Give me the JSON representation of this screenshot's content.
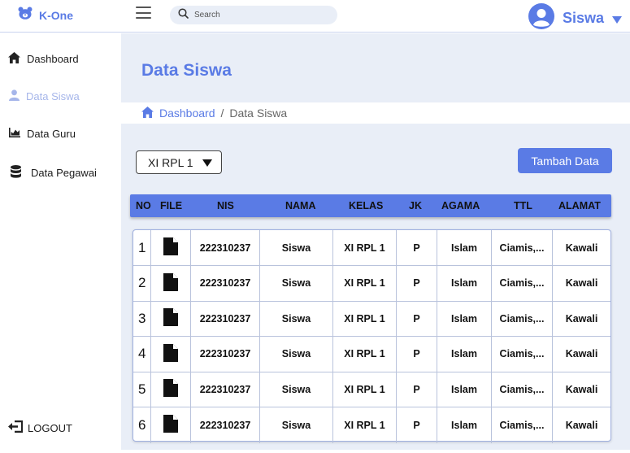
{
  "app": {
    "brand": "K-One"
  },
  "search": {
    "placeholder": "Search"
  },
  "user": {
    "name": "Siswa"
  },
  "sidebar": {
    "items": [
      {
        "label": "Dashboard",
        "icon": "home-icon"
      },
      {
        "label": "Data Siswa",
        "icon": "user-icon",
        "active": true
      },
      {
        "label": "Data Guru",
        "icon": "chart-icon"
      },
      {
        "label": "Data Pegawai",
        "icon": "database-icon"
      }
    ],
    "logout": "LOGOUT"
  },
  "page": {
    "title": "Data Siswa"
  },
  "breadcrumb": {
    "home": "Dashboard",
    "separator": "/",
    "current": "Data Siswa"
  },
  "filter": {
    "selected_class": "XI RPL 1"
  },
  "actions": {
    "add_label": "Tambah Data"
  },
  "table": {
    "headers": [
      "NO",
      "FILE",
      "NIS",
      "NAMA",
      "KELAS",
      "JK",
      "AGAMA",
      "TTL",
      "ALAMAT"
    ],
    "rows": [
      {
        "no": "1",
        "nis": "222310237",
        "nama": "Siswa",
        "kelas": "XI RPL 1",
        "jk": "P",
        "agama": "Islam",
        "ttl": "Ciamis,...",
        "alamat": "Kawali"
      },
      {
        "no": "2",
        "nis": "222310237",
        "nama": "Siswa",
        "kelas": "XI RPL 1",
        "jk": "P",
        "agama": "Islam",
        "ttl": "Ciamis,...",
        "alamat": "Kawali"
      },
      {
        "no": "3",
        "nis": "222310237",
        "nama": "Siswa",
        "kelas": "XI RPL 1",
        "jk": "P",
        "agama": "Islam",
        "ttl": "Ciamis,...",
        "alamat": "Kawali"
      },
      {
        "no": "4",
        "nis": "222310237",
        "nama": "Siswa",
        "kelas": "XI RPL 1",
        "jk": "P",
        "agama": "Islam",
        "ttl": "Ciamis,...",
        "alamat": "Kawali"
      },
      {
        "no": "5",
        "nis": "222310237",
        "nama": "Siswa",
        "kelas": "XI RPL 1",
        "jk": "P",
        "agama": "Islam",
        "ttl": "Ciamis,...",
        "alamat": "Kawali"
      },
      {
        "no": "6",
        "nis": "222310237",
        "nama": "Siswa",
        "kelas": "XI RPL 1",
        "jk": "P",
        "agama": "Islam",
        "ttl": "Ciamis,...",
        "alamat": "Kawali"
      }
    ]
  },
  "colors": {
    "accent": "#5a7be5",
    "main_bg": "#e9eef7",
    "sidebar_active": "#a6b6ea"
  }
}
